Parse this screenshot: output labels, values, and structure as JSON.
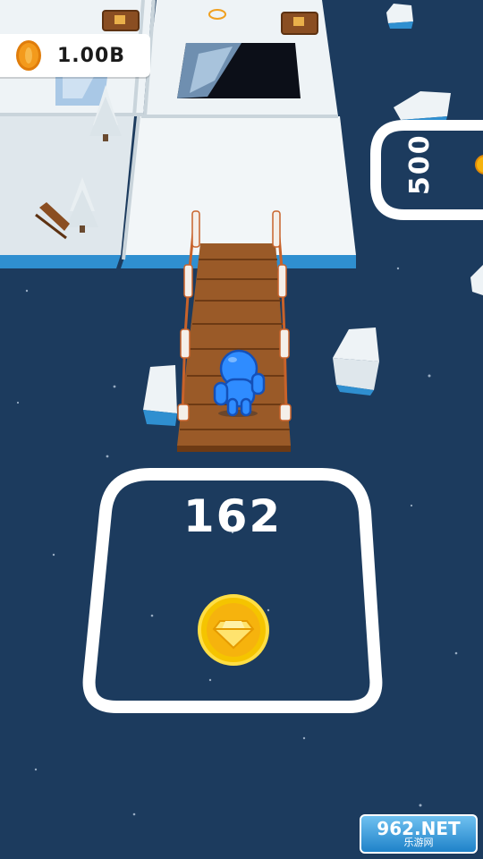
{
  "hud": {
    "coin_icon": "coin-icon",
    "coin_balance": "1.00B"
  },
  "zones": {
    "main_unlock_cost": "162",
    "main_reward_icon": "gem-coin-icon",
    "side_unlock_cost": "500"
  },
  "watermark": {
    "main": "962.NET",
    "sub": "乐游网"
  },
  "colors": {
    "water": "#1c3b5e",
    "ice": "#eef3f6",
    "ice_edge": "#2f8fd0",
    "bridge_wood": "#8a4e22",
    "player": "#2f8cff",
    "coin": "#f6b30d"
  }
}
